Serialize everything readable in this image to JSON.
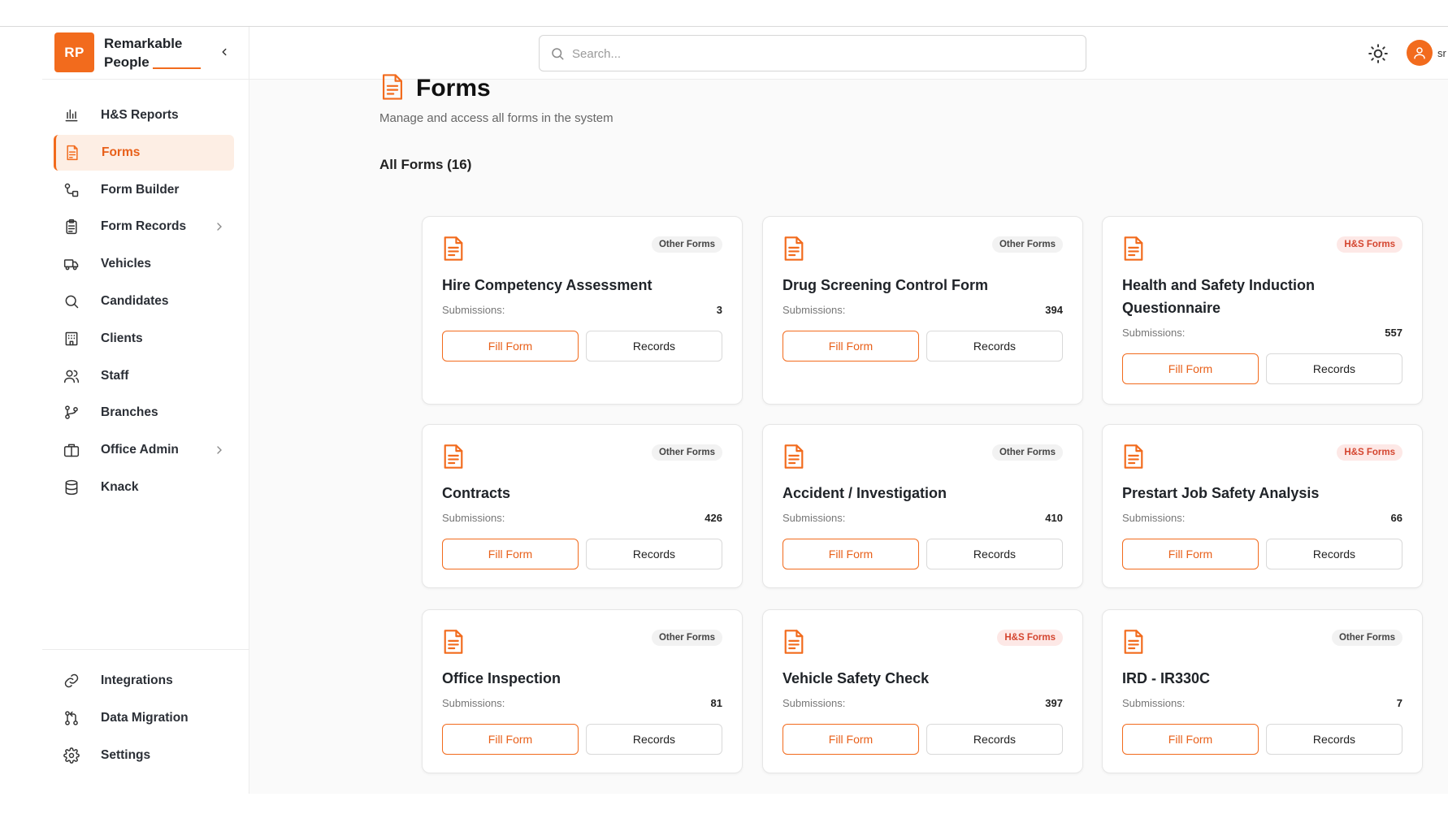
{
  "brand": {
    "logo": "RP",
    "name": "Remarkable People"
  },
  "sidebar": {
    "items": [
      {
        "label": "H&S Reports",
        "icon": "bar-chart-icon"
      },
      {
        "label": "Forms",
        "icon": "document-icon",
        "active": true
      },
      {
        "label": "Form Builder",
        "icon": "workflow-icon"
      },
      {
        "label": "Form Records",
        "icon": "clipboard-icon",
        "has_submenu": true
      },
      {
        "label": "Vehicles",
        "icon": "truck-icon"
      },
      {
        "label": "Candidates",
        "icon": "search-icon"
      },
      {
        "label": "Clients",
        "icon": "building-icon"
      },
      {
        "label": "Staff",
        "icon": "users-icon"
      },
      {
        "label": "Branches",
        "icon": "git-branch-icon"
      },
      {
        "label": "Office Admin",
        "icon": "briefcase-icon",
        "has_submenu": true
      },
      {
        "label": "Knack",
        "icon": "database-icon"
      }
    ],
    "bottom_items": [
      {
        "label": "Integrations",
        "icon": "link-icon"
      },
      {
        "label": "Data Migration",
        "icon": "git-pull-request-icon"
      },
      {
        "label": "Settings",
        "icon": "gear-icon"
      }
    ]
  },
  "header": {
    "search_placeholder": "Search...",
    "user_name": "sr"
  },
  "main": {
    "title": "Forms",
    "subtitle": "Manage and access all forms in the system",
    "section_title": "All Forms (16)",
    "submissions_label": "Submissions:",
    "fill_label": "Fill Form",
    "records_label": "Records",
    "cards": [
      {
        "title": "Hire Competency Assessment",
        "tag": "Other Forms",
        "tag_type": "other",
        "submissions": "3"
      },
      {
        "title": "Drug Screening Control Form",
        "tag": "Other Forms",
        "tag_type": "other",
        "submissions": "394"
      },
      {
        "title": "Health and Safety Induction Questionnaire",
        "tag": "H&S Forms",
        "tag_type": "hs",
        "submissions": "557"
      },
      {
        "title": "Contracts",
        "tag": "Other Forms",
        "tag_type": "other",
        "submissions": "426"
      },
      {
        "title": "Accident / Investigation",
        "tag": "Other Forms",
        "tag_type": "other",
        "submissions": "410"
      },
      {
        "title": "Prestart Job Safety Analysis",
        "tag": "H&S Forms",
        "tag_type": "hs",
        "submissions": "66"
      },
      {
        "title": "Office Inspection",
        "tag": "Other Forms",
        "tag_type": "other",
        "submissions": "81"
      },
      {
        "title": "Vehicle Safety Check",
        "tag": "H&S Forms",
        "tag_type": "hs",
        "submissions": "397"
      },
      {
        "title": "IRD - IR330C",
        "tag": "Other Forms",
        "tag_type": "other",
        "submissions": "7"
      }
    ]
  },
  "colors": {
    "accent": "#f26b1d",
    "accent_light": "#fdeee4",
    "hs_tag_bg": "#fde8e6",
    "hs_tag_text": "#d4452f"
  }
}
